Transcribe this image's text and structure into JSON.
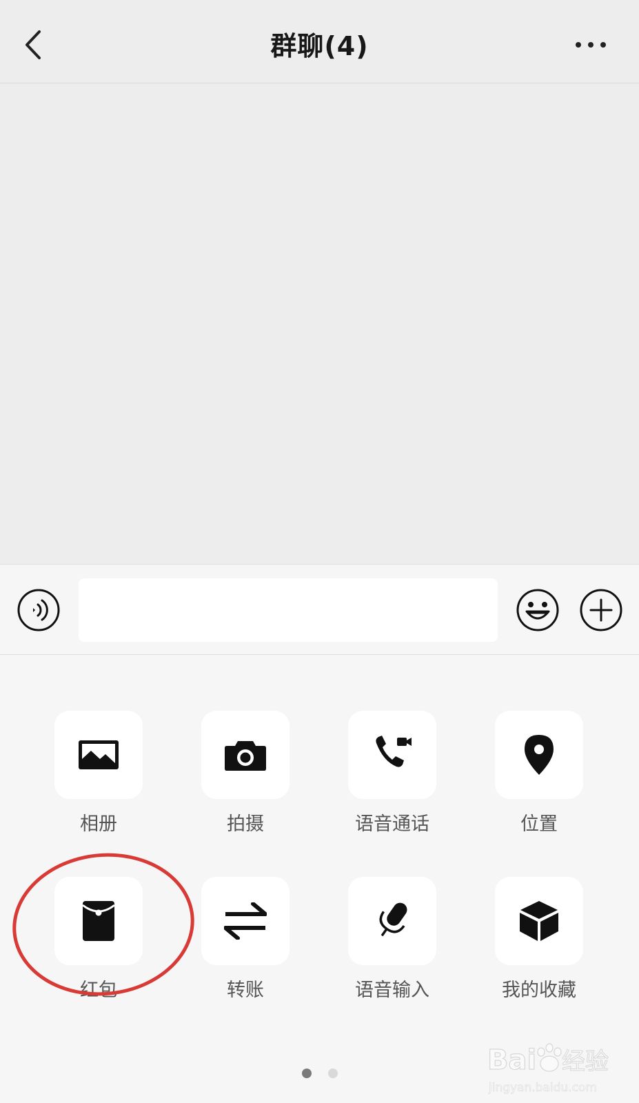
{
  "header": {
    "title": "群聊(4)"
  },
  "input": {
    "value": "",
    "placeholder": ""
  },
  "panel": {
    "items": [
      {
        "label": "相册",
        "icon": "photo-album-icon"
      },
      {
        "label": "拍摄",
        "icon": "camera-icon"
      },
      {
        "label": "语音通话",
        "icon": "voice-video-call-icon"
      },
      {
        "label": "位置",
        "icon": "location-pin-icon"
      },
      {
        "label": "红包",
        "icon": "red-packet-icon"
      },
      {
        "label": "转账",
        "icon": "transfer-arrows-icon"
      },
      {
        "label": "语音输入",
        "icon": "microphone-icon"
      },
      {
        "label": "我的收藏",
        "icon": "cube-favorites-icon"
      }
    ],
    "pages": 2,
    "current_page": 1
  },
  "annotation": {
    "highlight_color": "#d83a36",
    "highlighted_item": "红包"
  },
  "watermark": {
    "text": "Bai经验",
    "subtext": "jingyan.baidu.com"
  },
  "colors": {
    "background": "#ededed",
    "panel_background": "#f6f6f6",
    "tile_background": "#ffffff",
    "icon": "#111111"
  }
}
